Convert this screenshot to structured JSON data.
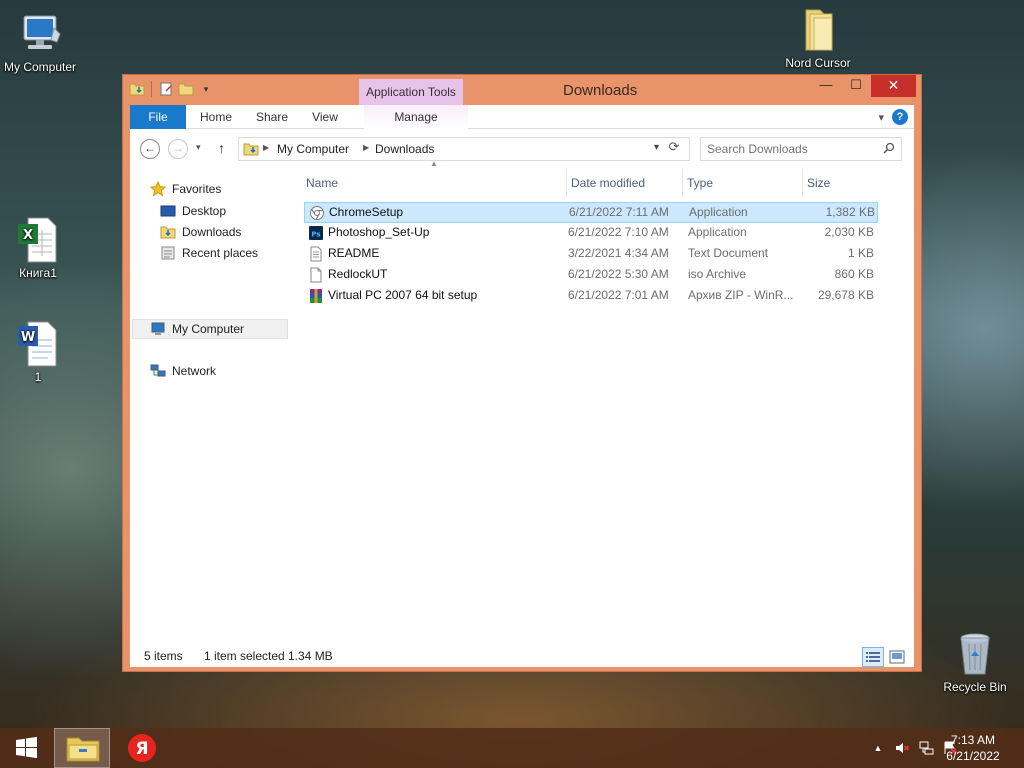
{
  "desktop": {
    "icons": [
      {
        "label": "My Computer"
      },
      {
        "label": "Nord Cursor"
      },
      {
        "label": "Книга1"
      },
      {
        "label": "1"
      },
      {
        "label": "Recycle Bin"
      }
    ]
  },
  "window": {
    "title": "Downloads",
    "context_tab": "Application Tools",
    "controls": {
      "minimize": "—",
      "maximize": "☐",
      "close": "✕"
    },
    "ribbon_tabs": [
      "File",
      "Home",
      "Share",
      "View",
      "Manage"
    ],
    "help": "?",
    "address": {
      "crumbs": [
        "My Computer",
        "Downloads"
      ]
    },
    "search": {
      "placeholder": "Search Downloads"
    }
  },
  "navpane": {
    "favorites": "Favorites",
    "items": [
      "Desktop",
      "Downloads",
      "Recent places"
    ],
    "computer": "My Computer",
    "network": "Network"
  },
  "filelist": {
    "columns": {
      "name": "Name",
      "date": "Date modified",
      "type": "Type",
      "size": "Size"
    },
    "rows": [
      {
        "name": "ChromeSetup",
        "date": "6/21/2022 7:11 AM",
        "type": "Application",
        "size": "1,382 KB",
        "icon": "chrome-setup-icon"
      },
      {
        "name": "Photoshop_Set-Up",
        "date": "6/21/2022 7:10 AM",
        "type": "Application",
        "size": "2,030 KB",
        "icon": "photoshop-icon"
      },
      {
        "name": "README",
        "date": "3/22/2021 4:34 AM",
        "type": "Text Document",
        "size": "1 KB",
        "icon": "text-document-icon"
      },
      {
        "name": "RedlockUT",
        "date": "6/21/2022 5:30 AM",
        "type": "iso Archive",
        "size": "860 KB",
        "icon": "blank-file-icon"
      },
      {
        "name": "Virtual PC 2007 64 bit setup",
        "date": "6/21/2022 7:01 AM",
        "type": "Архив ZIP - WinR...",
        "size": "29,678 KB",
        "icon": "winrar-archive-icon"
      }
    ],
    "selected_index": 0
  },
  "status": {
    "items": "5 items",
    "selected": "1 item selected",
    "size": "1.34 MB"
  },
  "taskbar": {
    "time": "7:13 AM",
    "date": "6/21/2022",
    "tray_up": "▲"
  },
  "colors": {
    "accent": "#1979ca",
    "window_frame": "#e8936a",
    "close": "#c7302a",
    "selection": "#cce8ff"
  }
}
